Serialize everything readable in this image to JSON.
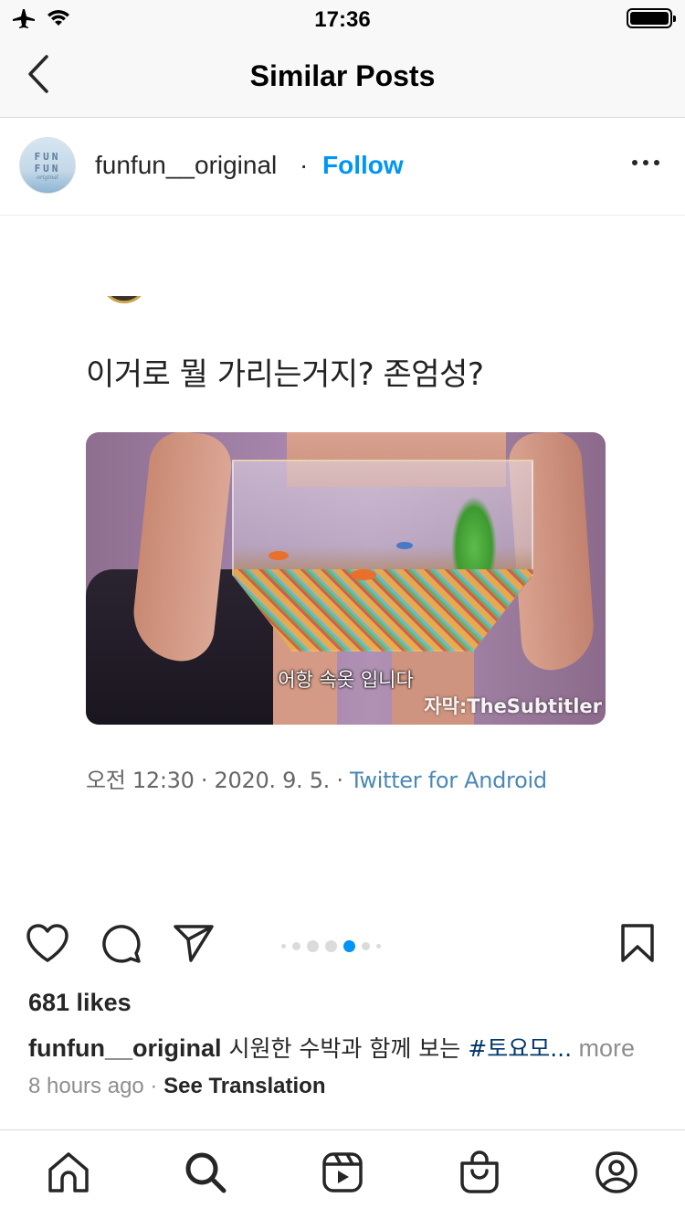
{
  "status_bar": {
    "time": "17:36",
    "icons": [
      "airplane-icon",
      "wifi-icon",
      "battery-icon"
    ]
  },
  "nav": {
    "title": "Similar Posts",
    "back_icon": "chevron-left-icon"
  },
  "post": {
    "username": "funfun__original",
    "separator": "·",
    "follow_label": "Follow",
    "more_icon": "more-horizontal-icon",
    "avatar_text": [
      "FUN",
      "FUN"
    ],
    "avatar_sub": "original",
    "media": {
      "tweet_text": "이거로 뭘 가리는거지? 존엄성?",
      "image_subtitle": "어항 속옷 입니다",
      "image_watermark": "자막:TheSubtitler",
      "tweet_meta": "오전 12:30 · 2020. 9. 5. · ",
      "tweet_source": "Twitter for Android"
    },
    "carousel": {
      "count": 7,
      "active_index": 4
    },
    "likes": "681 likes",
    "caption": {
      "user": "funfun__original",
      "text": " 시원한 수박과 함께 보는 ",
      "hashtag": "#토요모...",
      "more": " more"
    },
    "time_ago": "8 hours ago",
    "time_sep": " · ",
    "see_translation": "See Translation"
  },
  "tabs": [
    {
      "name": "home",
      "icon": "home-icon"
    },
    {
      "name": "search",
      "icon": "search-icon"
    },
    {
      "name": "reels",
      "icon": "reels-icon"
    },
    {
      "name": "shop",
      "icon": "shopping-bag-icon"
    },
    {
      "name": "profile",
      "icon": "profile-icon"
    }
  ],
  "colors": {
    "accent": "#0095f6",
    "hashtag": "#00376b",
    "muted": "#8e8e8e",
    "text": "#262626"
  }
}
